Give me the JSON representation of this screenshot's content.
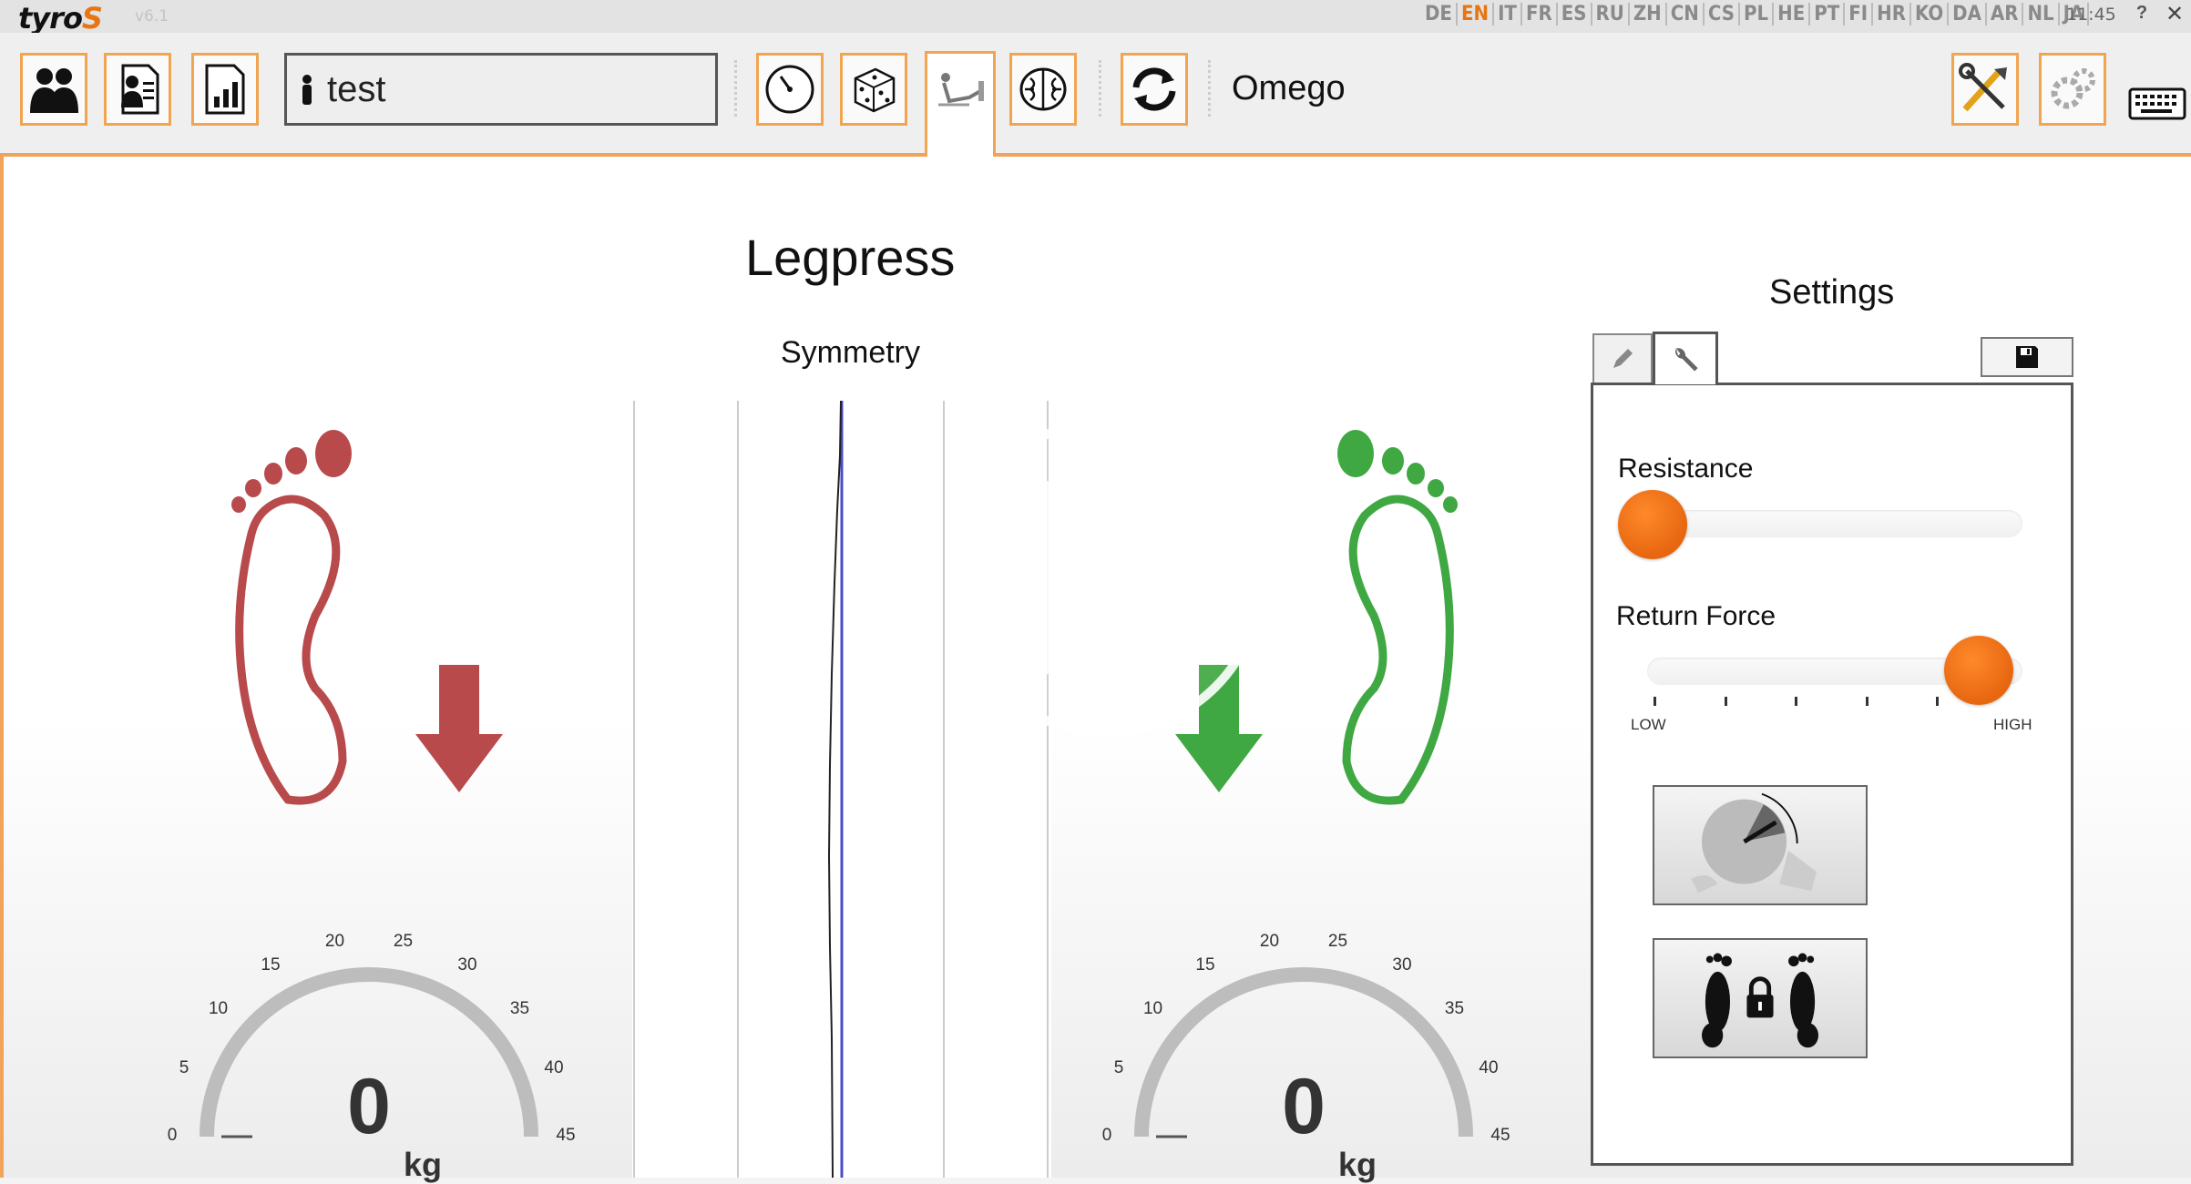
{
  "app": {
    "name": "tyro",
    "name_accent": "S",
    "version": "v6.1",
    "clock": "11:45",
    "help": "?",
    "close": "✕"
  },
  "languages": [
    "DE",
    "EN",
    "IT",
    "FR",
    "ES",
    "RU",
    "ZH",
    "CN",
    "CS",
    "PL",
    "HE",
    "PT",
    "FI",
    "HR",
    "KO",
    "DA",
    "AR",
    "NL",
    "JA"
  ],
  "active_language": "EN",
  "toolbar": {
    "user_name": "test",
    "machine_name": "Omego",
    "icons": [
      "patients-icon",
      "patient-file-icon",
      "statistics-icon",
      "timer-icon",
      "dice-icon",
      "legpress-exercise-icon",
      "brain-icon",
      "refresh-icon",
      "tools-icon",
      "gear-icon",
      "keyboard-icon"
    ]
  },
  "main": {
    "title": "Legpress",
    "symmetry_label": "Symmetry",
    "left_foot": {
      "color": "#b84a4c",
      "arrow": "down",
      "gauge_value": "0",
      "unit": "kg"
    },
    "right_foot": {
      "color": "#3fa842",
      "arrow": "down",
      "gauge_value": "0",
      "unit": "kg"
    },
    "gauge_ticks": [
      "0",
      "5",
      "10",
      "15",
      "20",
      "25",
      "30",
      "35",
      "40",
      "45"
    ]
  },
  "settings": {
    "title": "Settings",
    "resistance_label": "Resistance",
    "resistance_level": 0.0,
    "return_force_label": "Return Force",
    "return_force_level": 1.0,
    "low_label": "LOW",
    "high_label": "HIGH",
    "buttons": [
      "range-of-motion-button",
      "foot-lock-button"
    ]
  },
  "colors": {
    "accent": "#f2a551",
    "knob": "#e96d12"
  }
}
